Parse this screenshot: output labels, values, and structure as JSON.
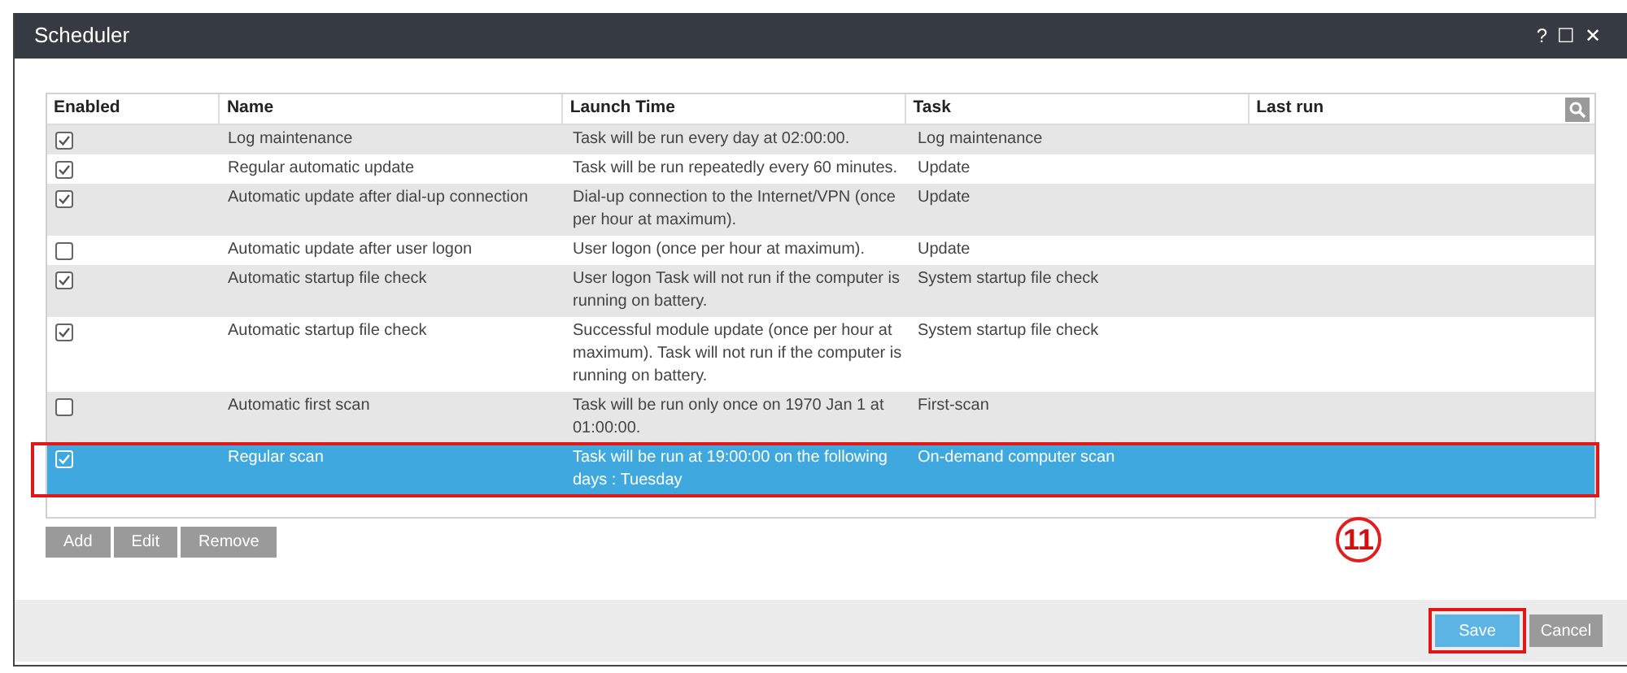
{
  "window": {
    "title": "Scheduler",
    "controls": [
      "?",
      "☐",
      "✕"
    ]
  },
  "table": {
    "columns": [
      "Enabled",
      "Name",
      "Launch Time",
      "Task",
      "Last run"
    ],
    "rows": [
      {
        "enabled": true,
        "selected": false,
        "highlighted": false,
        "name": "Log maintenance",
        "launch_time": "Task will be run every day at 02:00:00.",
        "task": "Log maintenance"
      },
      {
        "enabled": true,
        "selected": false,
        "highlighted": false,
        "name": "Regular automatic update",
        "launch_time": "Task will be run repeatedly every 60 minutes.",
        "task": "Update"
      },
      {
        "enabled": true,
        "selected": false,
        "highlighted": false,
        "name": "Automatic update after dial-up connection",
        "launch_time": "Dial-up connection to the Internet/VPN (once per hour at maximum).",
        "task": "Update"
      },
      {
        "enabled": false,
        "selected": false,
        "highlighted": false,
        "name": "Automatic update after user logon",
        "launch_time": "User logon (once per hour at maximum).",
        "task": "Update"
      },
      {
        "enabled": true,
        "selected": false,
        "highlighted": false,
        "name": "Automatic startup file check",
        "launch_time": "User logon Task will not run if the computer is running on battery.",
        "task": "System startup file check"
      },
      {
        "enabled": true,
        "selected": false,
        "highlighted": false,
        "name": "Automatic startup file check",
        "launch_time": "Successful module update (once per hour at maximum). Task will not run if the computer is running on battery.",
        "task": "System startup file check"
      },
      {
        "enabled": false,
        "selected": false,
        "highlighted": false,
        "name": "Automatic first scan",
        "launch_time": "Task will be run only once on 1970 Jan 1 at 01:00:00.",
        "task": "First-scan"
      },
      {
        "enabled": true,
        "selected": true,
        "highlighted": true,
        "name": "Regular scan",
        "launch_time": "Task will be run at 19:00:00 on the following days : Tuesday",
        "task": "On-demand computer scan"
      }
    ]
  },
  "table_buttons": [
    "Add",
    "Edit",
    "Remove"
  ],
  "step_marker": "11",
  "footer_buttons": [
    {
      "label": "Save",
      "kind": "primary",
      "highlighted": true
    },
    {
      "label": "Cancel",
      "kind": "secondary",
      "highlighted": false
    }
  ]
}
